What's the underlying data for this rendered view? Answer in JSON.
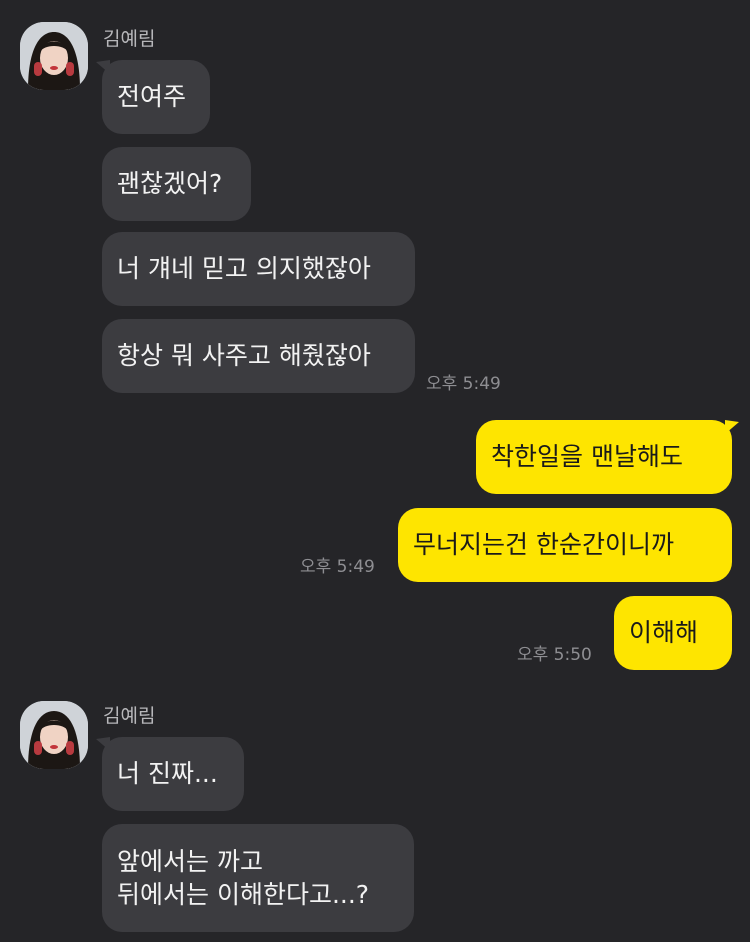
{
  "sender_name": "김예림",
  "groups": [
    {
      "messages": [
        "전여주",
        "괜찮겠어?",
        "너 걔네 믿고 의지했잖아",
        "항상 뭐 사주고 해줬잖아"
      ],
      "time": "오후 5:49"
    }
  ],
  "outgoing": [
    {
      "text": "착한일을 맨날해도"
    },
    {
      "text": "무너지는건 한순간이니까",
      "time": "오후 5:49"
    },
    {
      "text": "이해해",
      "time": "오후 5:50"
    }
  ],
  "group2": {
    "messages": [
      "너 진짜...",
      "앞에서는 까고\n뒤에서는 이해한다고...?"
    ]
  },
  "colors": {
    "background": "#252528",
    "incoming_bubble": "#3c3c40",
    "outgoing_bubble": "#fee500"
  }
}
